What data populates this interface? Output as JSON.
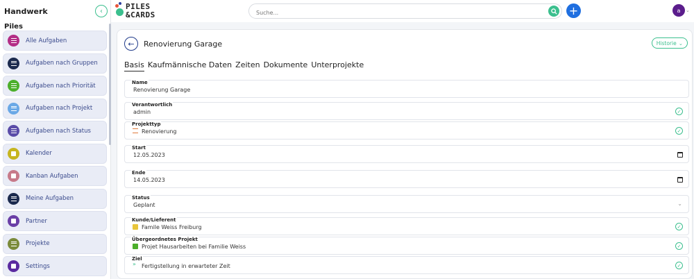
{
  "sidebar": {
    "title": "Handwerk",
    "section": "Piles",
    "items": [
      {
        "label": "Alle Aufgaben",
        "color": "#b32d86",
        "icon": "list-icon"
      },
      {
        "label": "Aufgaben nach Gruppen",
        "color": "#1b2a4e",
        "icon": "list-icon"
      },
      {
        "label": "Aufgaben nach Priorität",
        "color": "#4caf2b",
        "icon": "list-icon"
      },
      {
        "label": "Aufgaben nach Projekt",
        "color": "#6aa8e6",
        "icon": "list-icon"
      },
      {
        "label": "Aufgaben nach Status",
        "color": "#5a4ca8",
        "icon": "list-icon"
      },
      {
        "label": "Kalender",
        "color": "#c6b51f",
        "icon": "calendar-icon"
      },
      {
        "label": "Kanban Aufgaben",
        "color": "#c77a8a",
        "icon": "kanban-icon"
      },
      {
        "label": "Meine Aufgaben",
        "color": "#1b2a4e",
        "icon": "list-icon"
      },
      {
        "label": "Partner",
        "color": "#6a3fa6",
        "icon": "contact-icon"
      },
      {
        "label": "Projekte",
        "color": "#7a8a3a",
        "icon": "list-icon"
      },
      {
        "label": "Settings",
        "color": "#5a2aa0",
        "icon": "wrench-icon"
      }
    ]
  },
  "topbar": {
    "logo_line1": "PILES",
    "logo_line2": "&CARDS",
    "search_placeholder": "Suche...",
    "avatar_initial": "a"
  },
  "page": {
    "title": "Renovierung Garage",
    "history_label": "Historie",
    "tabs": [
      "Basis",
      "Kaufmännische Daten",
      "Zeiten",
      "Dokumente",
      "Unterprojekte"
    ],
    "fields": {
      "name": {
        "label": "Name",
        "value": "Renovierung Garage"
      },
      "owner": {
        "label": "Verantwortlich",
        "value": "admin"
      },
      "type": {
        "label": "Projekttyp",
        "value": "Renovierung",
        "icon_color": "#e07a3a"
      },
      "start": {
        "label": "Start",
        "value": "12.05.2023"
      },
      "end": {
        "label": "Ende",
        "value": "14.05.2023"
      },
      "status": {
        "label": "Status",
        "value": "Geplant"
      },
      "customer": {
        "label": "Kunde/Lieferent",
        "value": "Famile Weiss Freiburg",
        "icon_color": "#e8c53a"
      },
      "parent": {
        "label": "Übergeordnetes Projekt",
        "value": "Projet Hausarbeiten bei Familie Weiss",
        "icon_color": "#4caf2b"
      },
      "goal": {
        "label": "Ziel",
        "value": "Fertigstellung in erwarteter Zeit",
        "icon_color": "#3bbf8e"
      }
    }
  },
  "colors": {
    "accent": "#3bbf8e",
    "primary": "#1f6fe0",
    "avatar": "#5b1d8c"
  }
}
